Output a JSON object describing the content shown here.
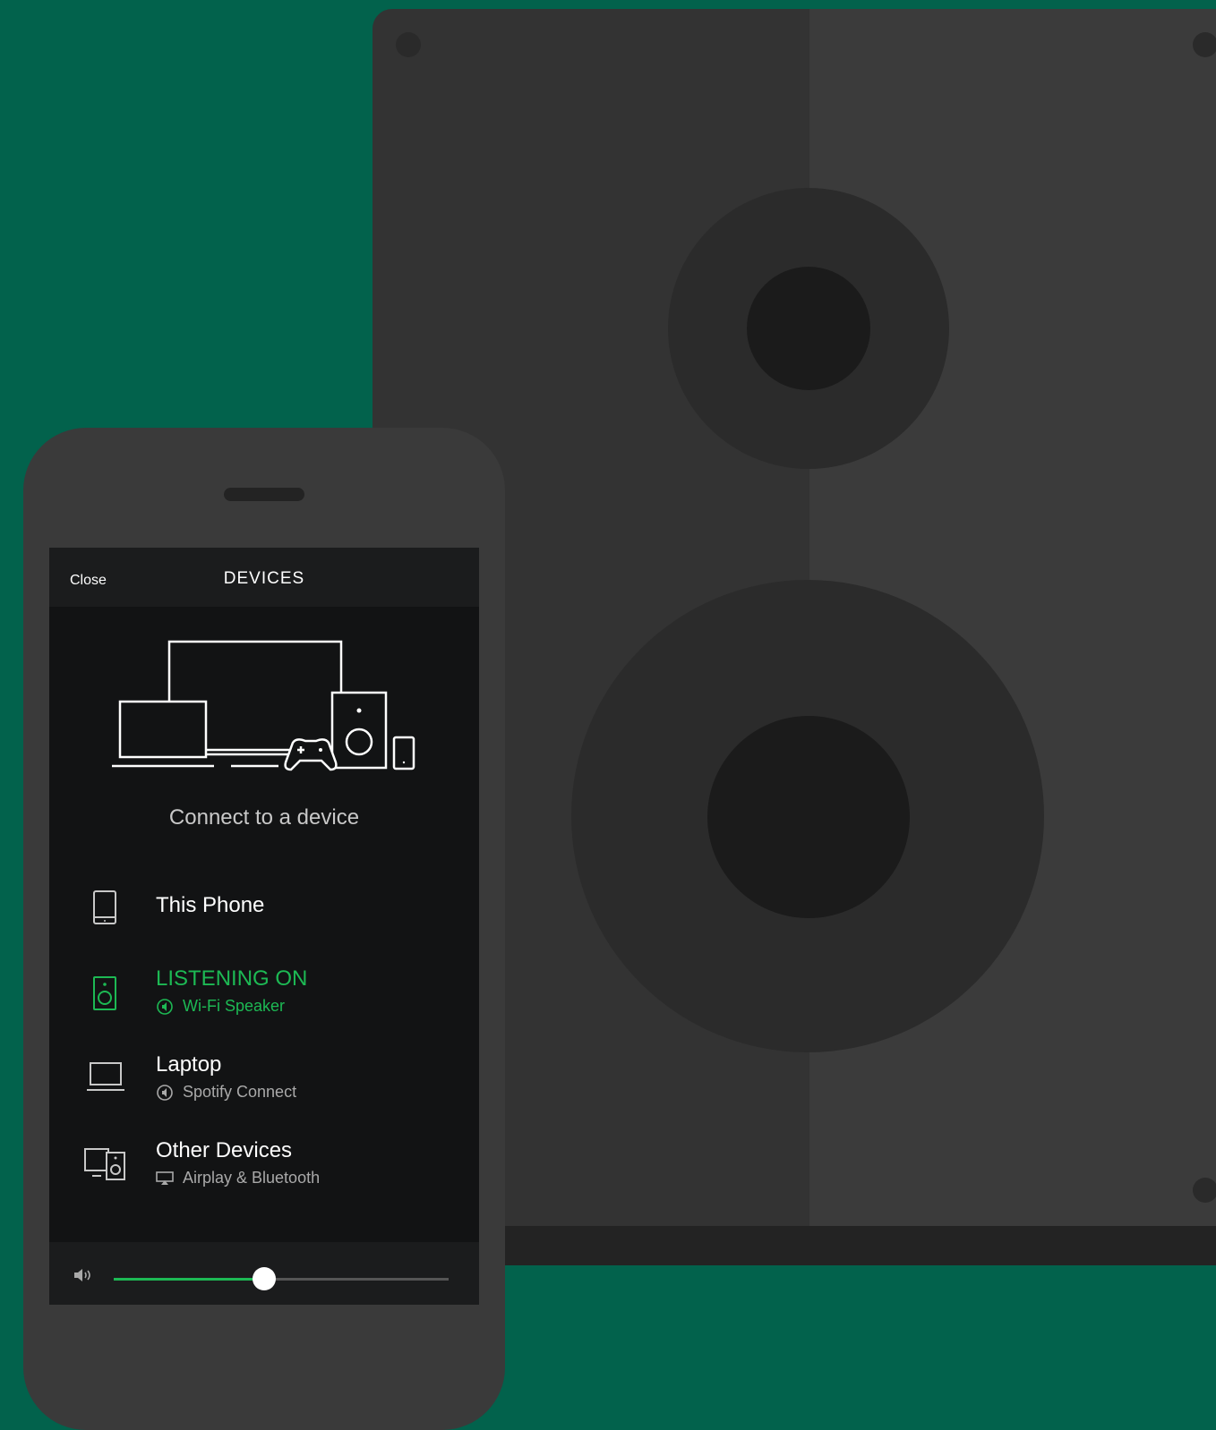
{
  "header": {
    "close_label": "Close",
    "title": "DEVICES"
  },
  "hero": {
    "icon": "devices-illustration-icon",
    "caption": "Connect to a device"
  },
  "devices": [
    {
      "title": "This Phone",
      "subtitle": "",
      "icon": "phone-icon",
      "active": false
    },
    {
      "title": "LISTENING ON",
      "subtitle": "Wi-Fi Speaker",
      "icon": "speaker-icon",
      "sub_icon": "spotify-connect-icon",
      "active": true
    },
    {
      "title": "Laptop",
      "subtitle": "Spotify Connect",
      "icon": "laptop-icon",
      "sub_icon": "spotify-connect-icon",
      "active": false
    },
    {
      "title": "Other Devices",
      "subtitle": "Airplay & Bluetooth",
      "icon": "other-devices-icon",
      "sub_icon": "airplay-icon",
      "active": false
    }
  ],
  "volume": {
    "icon": "volume-icon",
    "level": 0.45
  },
  "colors": {
    "background": "#02624c",
    "accent": "#1db954",
    "screen": "#121314",
    "phone_body": "#3a3a3a",
    "speaker_body": "#333333"
  }
}
